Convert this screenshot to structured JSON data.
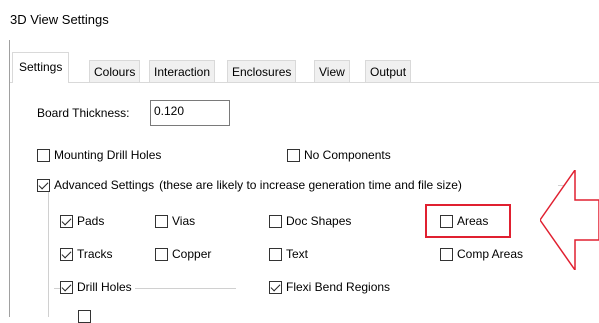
{
  "window": {
    "title": "3D View Settings"
  },
  "tabs": [
    {
      "label": "Settings",
      "active": true
    },
    {
      "label": "Colours"
    },
    {
      "label": "Interaction"
    },
    {
      "label": "Enclosures"
    },
    {
      "label": "View"
    },
    {
      "label": "Output"
    }
  ],
  "board_thickness": {
    "label": "Board Thickness:",
    "value": "0.120"
  },
  "mounting_drill_holes": {
    "label": "Mounting Drill Holes",
    "checked": false
  },
  "no_components": {
    "label": "No Components",
    "checked": false
  },
  "advanced_settings": {
    "label": "Advanced Settings",
    "note": "(these are likely to increase generation time and file size)",
    "checked": true
  },
  "options": {
    "pads": {
      "label": "Pads",
      "checked": true
    },
    "vias": {
      "label": "Vias",
      "checked": false
    },
    "doc_shapes": {
      "label": "Doc Shapes",
      "checked": false
    },
    "areas": {
      "label": "Areas",
      "checked": false
    },
    "tracks": {
      "label": "Tracks",
      "checked": true
    },
    "copper": {
      "label": "Copper",
      "checked": false
    },
    "text": {
      "label": "Text",
      "checked": false
    },
    "comp_areas": {
      "label": "Comp Areas",
      "checked": false
    },
    "drill_holes": {
      "label": "Drill Holes",
      "checked": true
    },
    "flexi_bend": {
      "label": "Flexi Bend Regions",
      "checked": true
    }
  },
  "colors": {
    "highlight": "#e02030"
  }
}
